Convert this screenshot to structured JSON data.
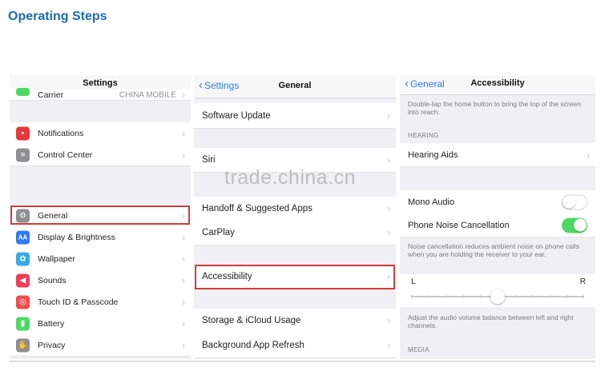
{
  "page_title": "Operating Steps",
  "watermark": "trade.china.cn",
  "settings_screen": {
    "title": "Settings",
    "carrier": {
      "label": "Carrier",
      "value": "CHINA MOBILE"
    },
    "group1": [
      {
        "label": "Notifications",
        "icon": "notifications-icon",
        "color": "#e5383b"
      },
      {
        "label": "Control Center",
        "icon": "control-center-icon",
        "color": "#8e8e93"
      }
    ],
    "group2": [
      {
        "label": "General",
        "icon": "gear-icon",
        "color": "#8e8e93"
      },
      {
        "label": "Display & Brightness",
        "icon": "display-icon",
        "color": "#2f7cf6",
        "glyph": "AA"
      },
      {
        "label": "Wallpaper",
        "icon": "wallpaper-icon",
        "color": "#35a9e8"
      },
      {
        "label": "Sounds",
        "icon": "sounds-icon",
        "color": "#ee3f58"
      },
      {
        "label": "Touch ID & Passcode",
        "icon": "fingerprint-icon",
        "color": "#ef4c4c"
      },
      {
        "label": "Battery",
        "icon": "battery-icon",
        "color": "#4cd964"
      },
      {
        "label": "Privacy",
        "icon": "hand-icon",
        "color": "#8e8e93"
      }
    ]
  },
  "general_screen": {
    "back_label": "Settings",
    "title": "General",
    "rows": {
      "software_update": "Software Update",
      "siri": "Siri",
      "handoff": "Handoff & Suggested Apps",
      "carplay": "CarPlay",
      "accessibility": "Accessibility",
      "storage": "Storage & iCloud Usage",
      "background_refresh": "Background App Refresh"
    }
  },
  "accessibility_screen": {
    "back_label": "General",
    "title": "Accessibility",
    "top_note": "Double-tap the home button to bring the top of the screen into reach.",
    "hearing_header": "HEARING",
    "hearing_aids": "Hearing Aids",
    "mono_audio": {
      "label": "Mono Audio",
      "on": false
    },
    "phone_noise": {
      "label": "Phone Noise Cancellation",
      "on": true
    },
    "noise_note": "Noise cancellation reduces ambient noise on phone calls when you are holding the receiver to your ear.",
    "balance": {
      "left": "L",
      "right": "R",
      "value": 0.5
    },
    "balance_note": "Adjust the audio volume balance between left and right channels.",
    "media_header": "MEDIA"
  },
  "colors": {
    "accent_blue": "#2b7de9",
    "title_blue": "#1b6bb3",
    "highlight_red": "#d23a3a",
    "toggle_green": "#4cd964"
  }
}
